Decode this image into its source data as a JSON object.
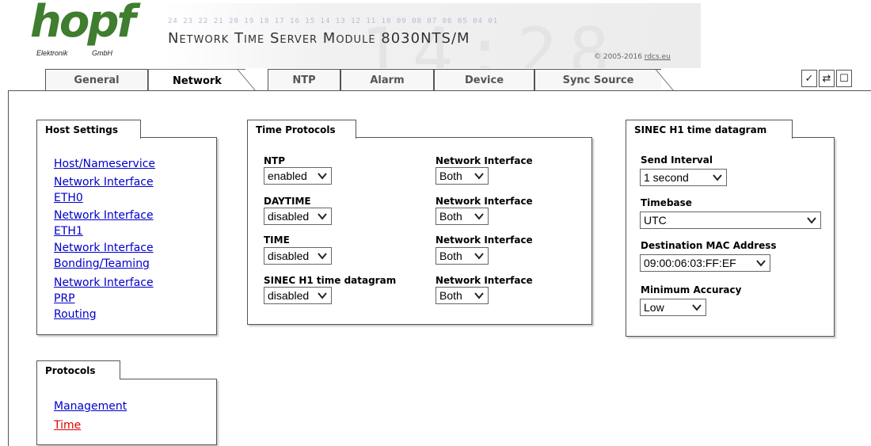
{
  "header": {
    "logo_text": "hopf",
    "logo_sub_left": "Elektronik",
    "logo_sub_right": "GmbH",
    "numbers_row": "24 23 22 21 20 19 18 17 16 15 14 13 12 11 10 09 08 07 06 05 04 01",
    "banner_digits": "14:28",
    "product_title": "Network Time Server Module 8030NTS/M",
    "copyright_prefix": "© 2005-2016 ",
    "copyright_link": "rdcs.eu"
  },
  "tabs": [
    {
      "label": "General",
      "active": false
    },
    {
      "label": "Network",
      "active": true
    },
    {
      "label": "NTP",
      "active": false
    },
    {
      "label": "Alarm",
      "active": false
    },
    {
      "label": "Device",
      "active": false
    },
    {
      "label": "Sync Source",
      "active": false
    }
  ],
  "toolbar": {
    "apply_icon": "check-icon",
    "apply_glyph": "✓",
    "reload_icon": "refresh-icon",
    "reload_glyph": "⇄",
    "save_icon": "save-icon",
    "save_glyph": "☐"
  },
  "host_settings": {
    "title": "Host Settings",
    "links": [
      {
        "lines": [
          "Host/Nameservice"
        ]
      },
      {
        "lines": [
          "Network Interface",
          "ETH0"
        ]
      },
      {
        "lines": [
          "Network Interface",
          "ETH1"
        ]
      },
      {
        "lines": [
          "Network Interface",
          "Bonding/Teaming"
        ]
      },
      {
        "lines": [
          "Network Interface",
          "PRP"
        ]
      },
      {
        "lines": [
          "Routing"
        ]
      }
    ]
  },
  "protocols": {
    "title": "Protocols",
    "links": [
      {
        "label": "Management",
        "active": false
      },
      {
        "label": "Time",
        "active": true
      }
    ]
  },
  "time_protocols": {
    "title": "Time Protocols",
    "rows": [
      {
        "protocol_label": "NTP",
        "protocol_value": "enabled",
        "iface_label": "Network Interface",
        "iface_value": "Both"
      },
      {
        "protocol_label": "DAYTIME",
        "protocol_value": "disabled",
        "iface_label": "Network Interface",
        "iface_value": "Both"
      },
      {
        "protocol_label": "TIME",
        "protocol_value": "disabled",
        "iface_label": "Network Interface",
        "iface_value": "Both"
      },
      {
        "protocol_label": "SINEC H1 time datagram",
        "protocol_value": "disabled",
        "iface_label": "Network Interface",
        "iface_value": "Both"
      }
    ]
  },
  "sinec": {
    "title": "SINEC H1 time datagram",
    "send_interval_label": "Send Interval",
    "send_interval_value": "1 second",
    "timebase_label": "Timebase",
    "timebase_value": "UTC",
    "dest_mac_label": "Destination MAC Address",
    "dest_mac_value": "09:00:06:03:FF:EF",
    "min_accuracy_label": "Minimum Accuracy",
    "min_accuracy_value": "Low"
  },
  "colors": {
    "logo_green": "#3f7d2f",
    "link_blue": "#0000cc",
    "link_active_red": "#dd0000"
  }
}
